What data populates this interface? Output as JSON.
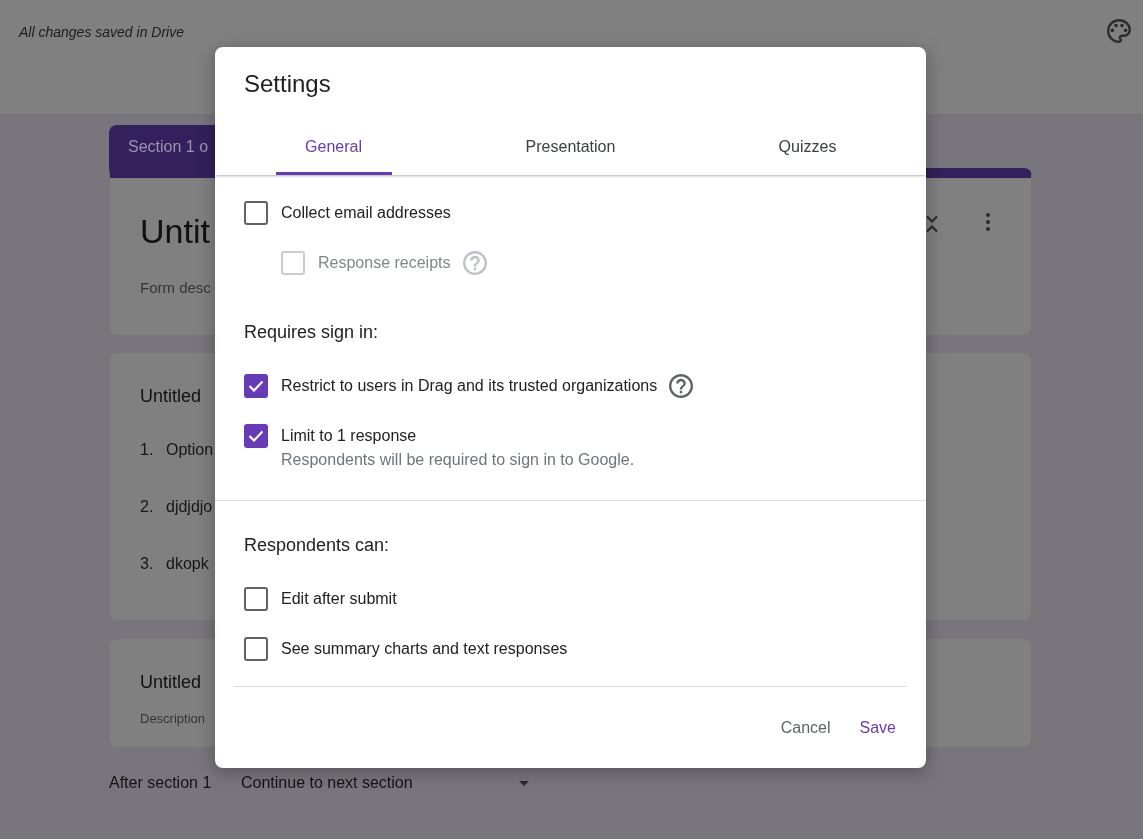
{
  "header": {
    "save_status": "All changes saved in Drive"
  },
  "form": {
    "section_tab": "Section 1 o",
    "header_card": {
      "title": "Untit",
      "placeholder": "Form desc"
    },
    "question_card": {
      "title": "Untitled",
      "options": [
        {
          "number": "1.",
          "label": "Option"
        },
        {
          "number": "2.",
          "label": "djdjdjo"
        },
        {
          "number": "3.",
          "label": "dkopk"
        }
      ]
    },
    "text_card": {
      "title": "Untitled",
      "placeholder": "Description"
    },
    "after_section": {
      "label": "After section 1",
      "value": "Continue to next section"
    }
  },
  "dialog": {
    "title": "Settings",
    "tabs": [
      {
        "label": "General",
        "selected": true
      },
      {
        "label": "Presentation",
        "selected": false
      },
      {
        "label": "Quizzes",
        "selected": false
      }
    ],
    "sections": [
      {
        "groups": [
          {
            "items": [
              {
                "label": "Collect email addresses",
                "checked": false,
                "disabled": false,
                "help": false,
                "children": [
                  {
                    "label": "Response receipts",
                    "checked": false,
                    "disabled": true,
                    "help": true
                  }
                ]
              }
            ]
          },
          {
            "heading": "Requires sign in:",
            "items": [
              {
                "label": "Restrict to users in Drag and its trusted organizations",
                "checked": true,
                "disabled": false,
                "help": true
              },
              {
                "label": "Limit to 1 response",
                "checked": true,
                "disabled": false,
                "help": false,
                "description": "Respondents will be required to sign in to Google."
              }
            ]
          }
        ]
      },
      {
        "groups": [
          {
            "heading": "Respondents can:",
            "items": [
              {
                "label": "Edit after submit",
                "checked": false,
                "disabled": false,
                "help": false
              },
              {
                "label": "See summary charts and text responses",
                "checked": false,
                "disabled": false,
                "help": false
              }
            ]
          }
        ]
      }
    ],
    "buttons": [
      {
        "label": "Cancel",
        "kind": "secondary"
      },
      {
        "label": "Save",
        "kind": "primary"
      }
    ]
  }
}
